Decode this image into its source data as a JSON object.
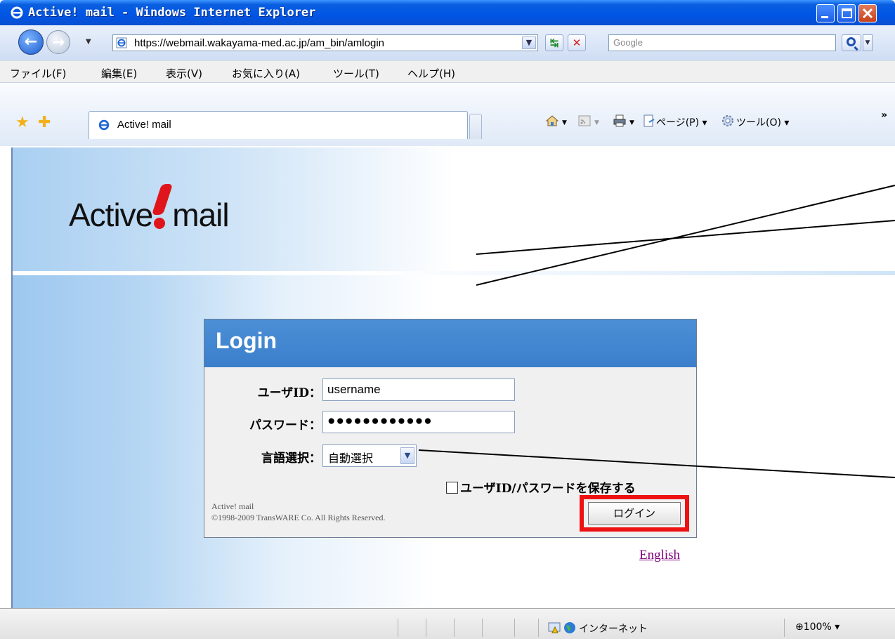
{
  "window": {
    "title": "Active! mail - Windows Internet Explorer"
  },
  "addressbar": {
    "url": "https://webmail.wakayama-med.ac.jp/am_bin/amlogin",
    "search_placeholder": "Google"
  },
  "menu": {
    "items": [
      "ファイル(F)",
      "編集(E)",
      "表示(V)",
      "お気に入り(A)",
      "ツール(T)",
      "ヘルプ(H)"
    ]
  },
  "tabs": {
    "active_label": "Active! mail"
  },
  "commandbar": {
    "page_label": "ページ(P)",
    "tools_label": "ツール(O)",
    "chevron": "»"
  },
  "logo": {
    "left": "Active",
    "right": "mail"
  },
  "login": {
    "header": "Login",
    "userid_label": "ユーザID：",
    "userid_value": "username",
    "password_label": "パスワード：",
    "password_value": "●●●●●●●●●●●●",
    "language_label": "言語選択：",
    "language_value": "自動選択",
    "save_label": "ユーザID/パスワードを保存する",
    "copyright_line1": "Active! mail",
    "copyright_line2": "©1998-2009 TransWARE Co. All Rights Reserved.",
    "login_button": "ログイン",
    "english_link": "English"
  },
  "statusbar": {
    "zone": "インターネット",
    "zoom": "100%"
  },
  "colors": {
    "titlebar": "#0055e5",
    "login_header": "#4c8fd6",
    "highlight": "#ee1111",
    "link_visited": "#800080"
  }
}
